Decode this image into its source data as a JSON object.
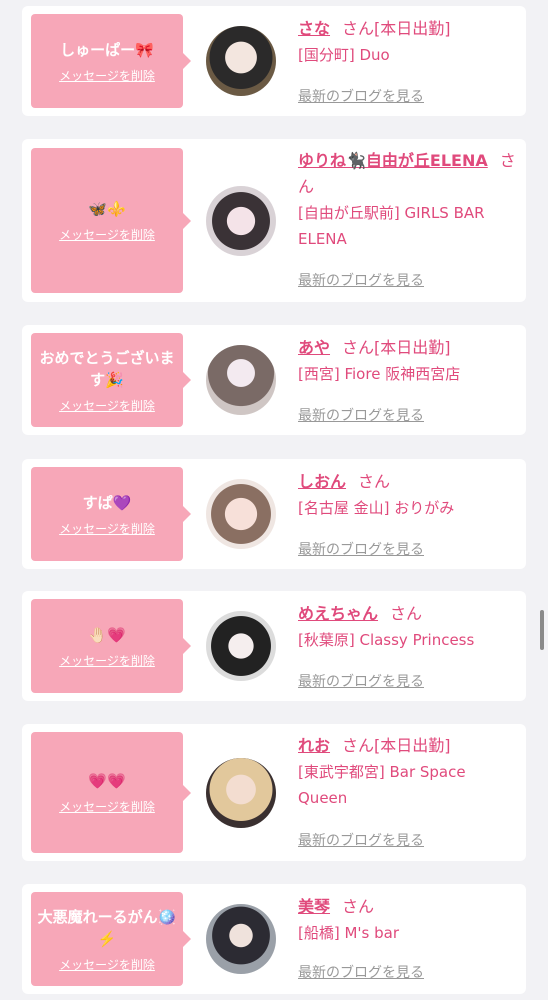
{
  "cards": [
    {
      "bubble_text": "しゅーぱー🎀",
      "delete_label": "メッセージを削除",
      "name": "さな",
      "san": "さん",
      "badge": "[本日出勤]",
      "shop": "[国分町] Duo",
      "blog_label": "最新のブログを見る"
    },
    {
      "bubble_text": "🦋⚜️",
      "delete_label": "メッセージを削除",
      "name": "ゆりね🐈‍⬛自由が丘ELENA",
      "san": "さん",
      "badge": "",
      "shop": "[自由が丘駅前] GIRLS BAR ELENA",
      "blog_label": "最新のブログを見る"
    },
    {
      "bubble_text": "おめでとうございます🎉",
      "delete_label": "メッセージを削除",
      "name": "あや",
      "san": "さん",
      "badge": "[本日出勤]",
      "shop": "[西宮] Fiore 阪神西宮店",
      "blog_label": "最新のブログを見る"
    },
    {
      "bubble_text": "すぱ💜",
      "delete_label": "メッセージを削除",
      "name": "しおん",
      "san": "さん",
      "badge": "",
      "shop": "[名古屋 金山] おりがみ",
      "blog_label": "最新のブログを見る"
    },
    {
      "bubble_text": "🤚🏻💗",
      "delete_label": "メッセージを削除",
      "name": "めえちゃん",
      "san": "さん",
      "badge": "",
      "shop": "[秋葉原] Classy Princess",
      "blog_label": "最新のブログを見る"
    },
    {
      "bubble_text": "💗💗",
      "delete_label": "メッセージを削除",
      "name": "れお",
      "san": "さん",
      "badge": "[本日出勤]",
      "shop": "[東武宇都宮] Bar Space Queen",
      "blog_label": "最新のブログを見る"
    },
    {
      "bubble_text": "大悪魔れーるがん🪩⚡️",
      "delete_label": "メッセージを削除",
      "name": "美琴",
      "san": "さん",
      "badge": "",
      "shop": "[船橋] M's bar",
      "blog_label": "最新のブログを見る"
    }
  ],
  "colors": {
    "accent_pink": "#e04a7c",
    "bubble_pink": "#f7a7b8",
    "link_gray": "#999999"
  }
}
